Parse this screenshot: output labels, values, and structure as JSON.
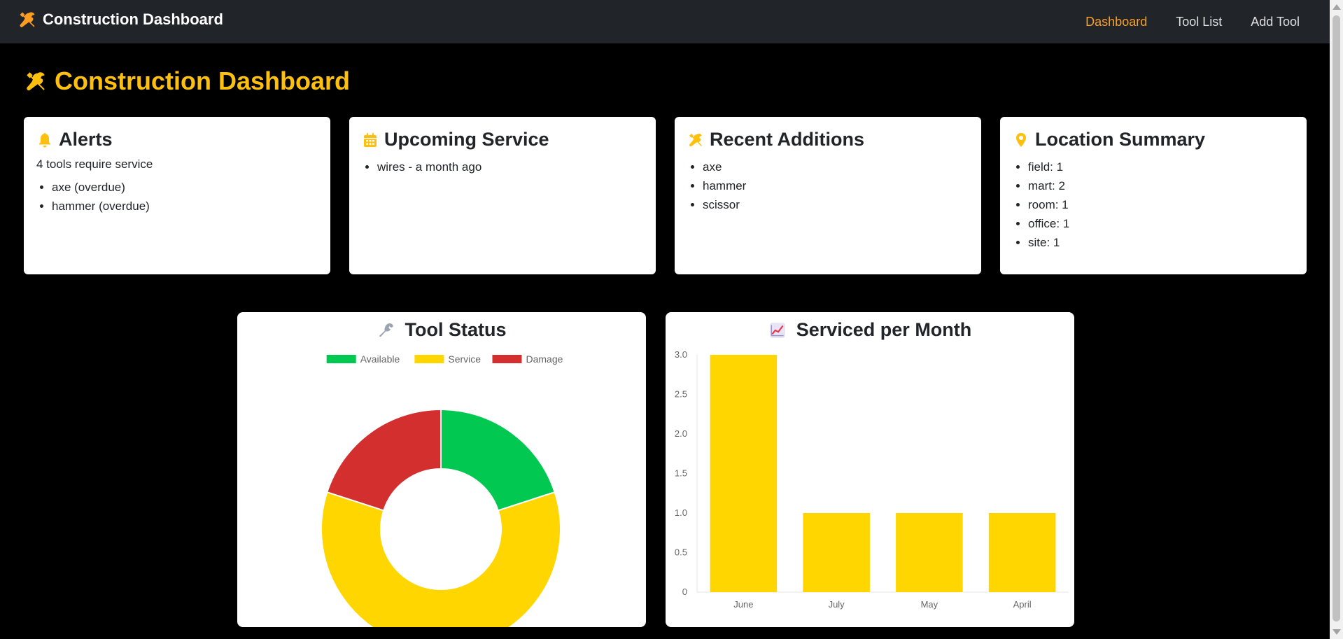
{
  "nav": {
    "brand": "Construction Dashboard",
    "links": [
      {
        "label": "Dashboard",
        "active": true
      },
      {
        "label": "Tool List",
        "active": false
      },
      {
        "label": "Add Tool",
        "active": false
      }
    ]
  },
  "page": {
    "title": "Construction Dashboard"
  },
  "cards": {
    "alerts": {
      "icon": "bell-icon",
      "title": "Alerts",
      "summary": "4 tools require service",
      "items": [
        "axe (overdue)",
        "hammer (overdue)"
      ]
    },
    "upcoming": {
      "icon": "calendar-icon",
      "title": "Upcoming Service",
      "items": [
        "wires - a month ago"
      ]
    },
    "recent": {
      "icon": "tools-icon",
      "title": "Recent Additions",
      "items": [
        "axe",
        "hammer",
        "scissor"
      ]
    },
    "locations": {
      "icon": "map-pin-icon",
      "title": "Location Summary",
      "items": [
        "field: 1",
        "mart: 2",
        "room: 1",
        "office: 1",
        "site: 1"
      ]
    }
  },
  "colors": {
    "accent": "#fec00f",
    "nav_active": "#fd9e22",
    "available": "#00c851",
    "service": "#ffd600",
    "damage": "#d32f2f"
  },
  "chart_data": [
    {
      "type": "pie",
      "title": "Tool Status",
      "title_icon": "wrench-icon",
      "labels": [
        "Available",
        "Service",
        "Damage"
      ],
      "values": [
        1,
        3,
        1
      ],
      "colors": [
        "#00c851",
        "#ffd600",
        "#d32f2f"
      ],
      "legend": "top",
      "donut": true
    },
    {
      "type": "bar",
      "title": "Serviced per Month",
      "title_icon": "chart-increasing-icon",
      "categories": [
        "June",
        "July",
        "May",
        "April"
      ],
      "values": [
        3,
        1,
        1,
        1
      ],
      "ylim": [
        0,
        3
      ],
      "yticks": [
        "0",
        "0.5",
        "1.0",
        "1.5",
        "2.0",
        "2.5",
        "3.0"
      ],
      "color": "#ffd600",
      "grid": false
    }
  ]
}
